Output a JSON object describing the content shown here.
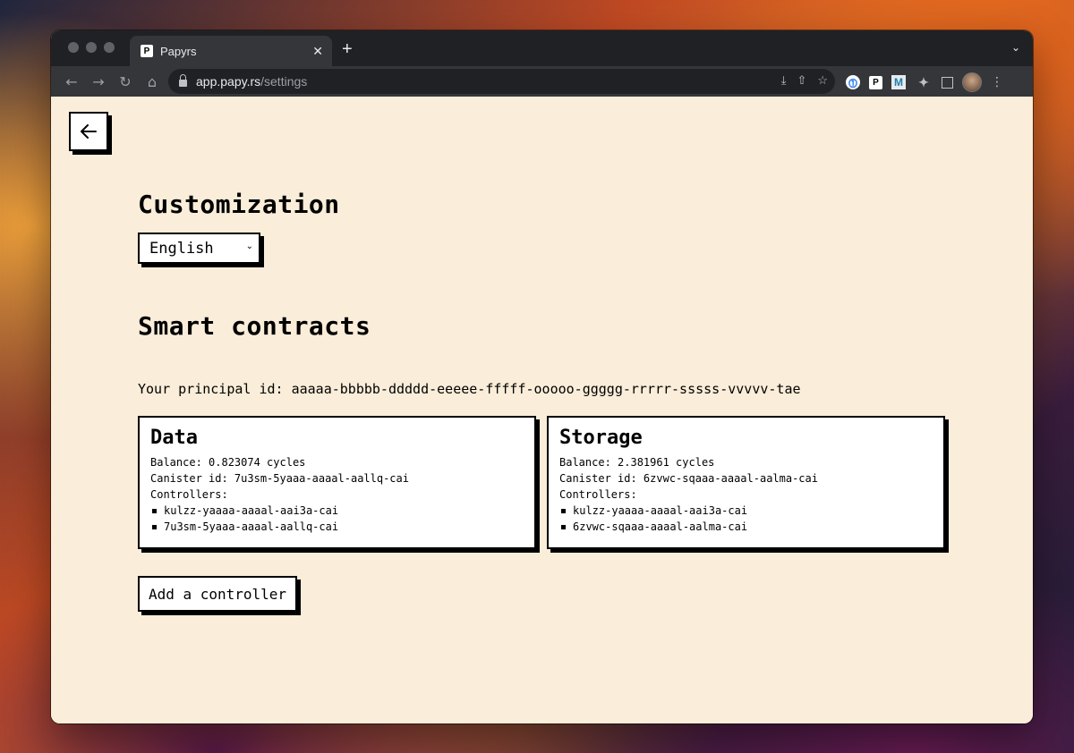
{
  "browser": {
    "tab_title": "Papyrs",
    "favicon_letter": "P",
    "url_host": "app.papy.rs",
    "url_path": "/settings",
    "extensions": [
      "1password-icon",
      "papyrs-icon",
      "m-icon",
      "puzzle-icon",
      "sidepanel-icon"
    ]
  },
  "customization": {
    "heading": "Customization",
    "language_selected": "English"
  },
  "smart_contracts": {
    "heading": "Smart contracts",
    "principal_text": "Your principal id: aaaaa-bbbbb-ddddd-eeeee-fffff-ooooo-ggggg-rrrrr-sssss-vvvvv-tae",
    "cards": [
      {
        "title": "Data",
        "balance": "Balance: 0.823074 cycles",
        "canister": "Canister id: 7u3sm-5yaaa-aaaal-aallq-cai",
        "controllers_label": "Controllers:",
        "controllers": [
          "kulzz-yaaaa-aaaal-aai3a-cai",
          "7u3sm-5yaaa-aaaal-aallq-cai"
        ]
      },
      {
        "title": "Storage",
        "balance": "Balance: 2.381961 cycles",
        "canister": "Canister id: 6zvwc-sqaaa-aaaal-aalma-cai",
        "controllers_label": "Controllers:",
        "controllers": [
          "kulzz-yaaaa-aaaal-aai3a-cai",
          "6zvwc-sqaaa-aaaal-aalma-cai"
        ]
      }
    ],
    "add_controller_label": "Add a controller"
  }
}
